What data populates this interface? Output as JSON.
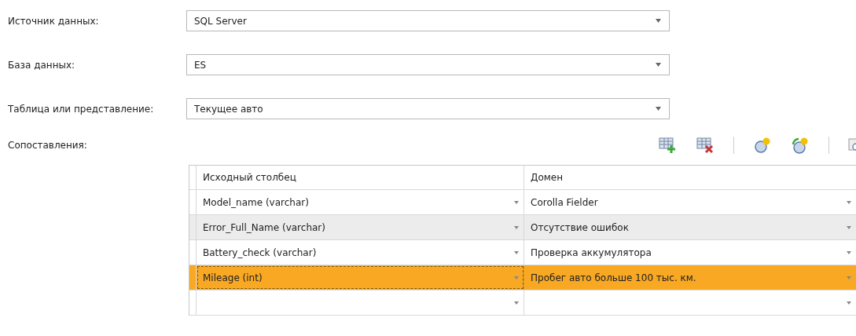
{
  "fields": [
    {
      "label": "Источник данных:",
      "value": "SQL Server"
    },
    {
      "label": "База данных:",
      "value": "ES"
    },
    {
      "label": "Таблица или представление:",
      "value": "Текущее авто"
    }
  ],
  "mappings": {
    "label": "Сопоставления:",
    "toolbar": [
      {
        "kind": "add-row"
      },
      {
        "kind": "delete-row"
      },
      {
        "kind": "separator"
      },
      {
        "kind": "new-domain"
      },
      {
        "kind": "new-composite"
      },
      {
        "kind": "separator"
      },
      {
        "kind": "preview"
      }
    ],
    "table": {
      "columns": [
        "Исходный столбец",
        "Домен"
      ],
      "rows": [
        {
          "cells": [
            "Model_name (varchar)",
            "Corolla Fielder"
          ],
          "selected": false
        },
        {
          "cells": [
            "Error_Full_Name (varchar)",
            "Отсутствие ошибок"
          ],
          "selected": false
        },
        {
          "cells": [
            "Battery_check (varchar)",
            "Проверка аккумулятора"
          ],
          "selected": false
        },
        {
          "cells": [
            "Mileage (int)",
            "Пробег авто больше 100 тыс. км."
          ],
          "selected": true
        },
        {
          "cells": [
            "",
            ""
          ],
          "selected": false
        }
      ]
    }
  }
}
